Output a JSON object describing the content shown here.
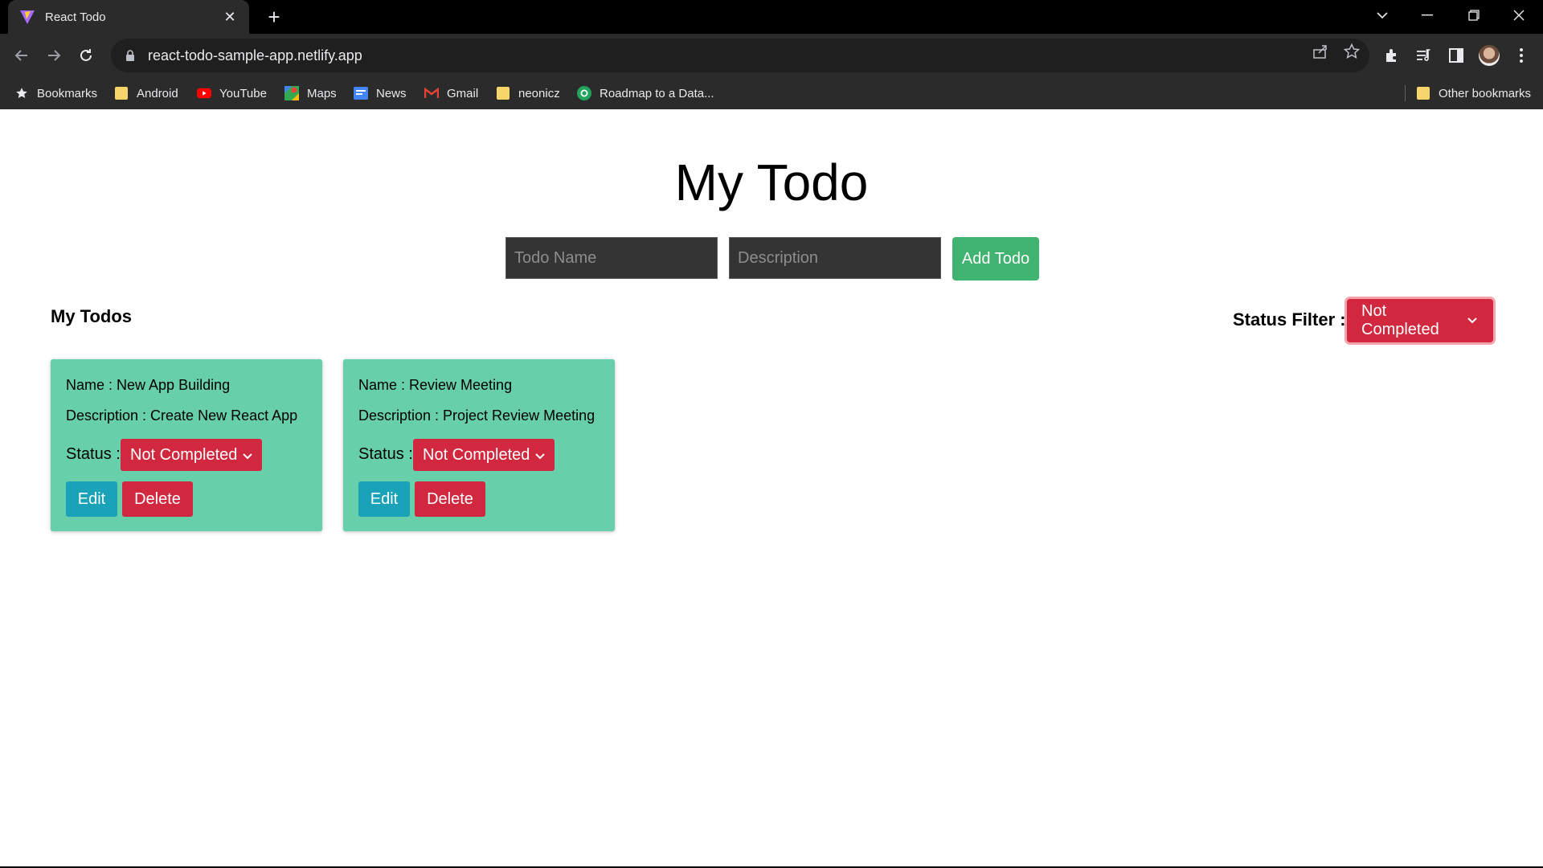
{
  "browser": {
    "tab_title": "React Todo",
    "tab_close": "✕",
    "new_tab": "+",
    "url": "react-todo-sample-app.netlify.app",
    "bookmarks": [
      {
        "label": "Bookmarks",
        "icon": "star-icon"
      },
      {
        "label": "Android",
        "icon": "folder-icon"
      },
      {
        "label": "YouTube",
        "icon": "youtube-icon"
      },
      {
        "label": "Maps",
        "icon": "maps-icon"
      },
      {
        "label": "News",
        "icon": "news-icon"
      },
      {
        "label": "Gmail",
        "icon": "gmail-icon"
      },
      {
        "label": "neonicz",
        "icon": "folder-icon"
      },
      {
        "label": "Roadmap to a Data...",
        "icon": "roadmap-icon"
      }
    ],
    "other_bookmarks": "Other bookmarks"
  },
  "app": {
    "title": "My Todo",
    "form": {
      "name_placeholder": "Todo Name",
      "description_placeholder": "Description",
      "add_button": "Add Todo"
    },
    "section_title": "My Todos",
    "filter": {
      "label": "Status Filter :",
      "selected": "Not Completed"
    },
    "todos": [
      {
        "name": "Name : New App Building",
        "description": "Description : Create New React App",
        "status_label": "Status :",
        "status": "Not Completed",
        "edit": "Edit",
        "delete": "Delete"
      },
      {
        "name": "Name : Review Meeting",
        "description": "Description : Project Review Meeting",
        "status_label": "Status :",
        "status": "Not Completed",
        "edit": "Edit",
        "delete": "Delete"
      }
    ]
  },
  "colors": {
    "card_bg": "#67cfa9",
    "danger": "#d1283f",
    "info": "#1aa3b8",
    "success": "#3fb36f"
  }
}
